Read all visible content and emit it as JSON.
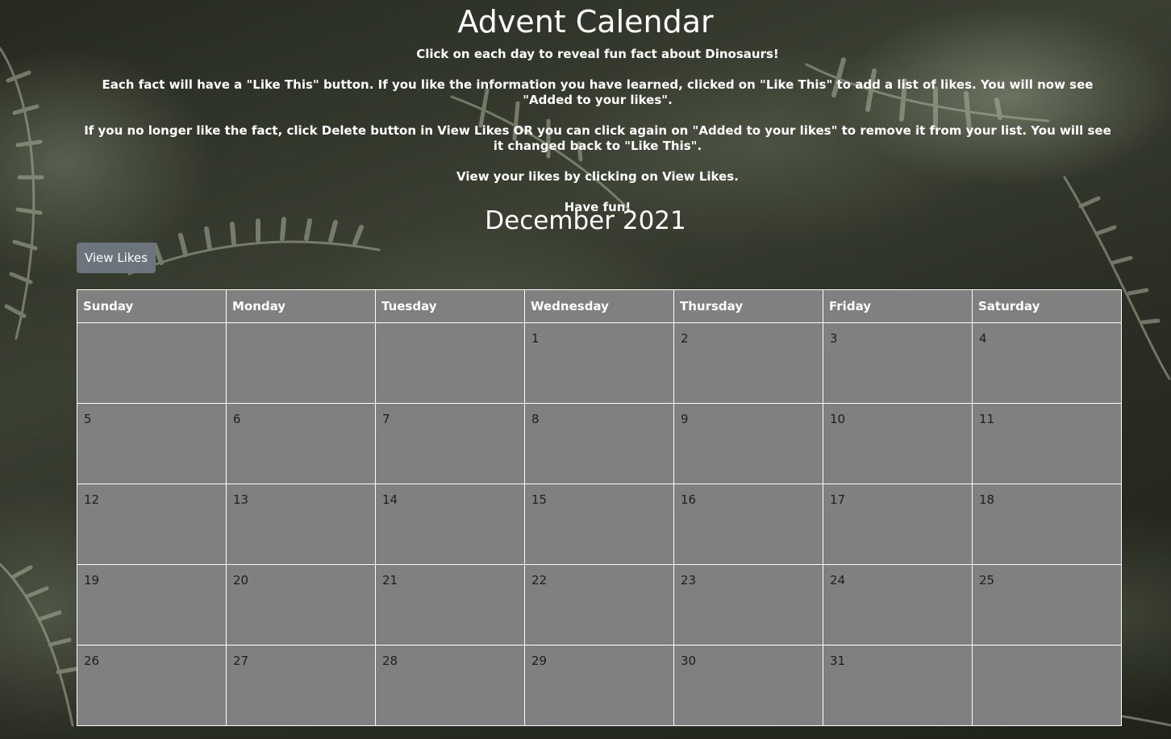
{
  "page": {
    "title": "Advent Calendar",
    "instructions": [
      "Click on each day to reveal fun fact about Dinosaurs!",
      "Each fact will have a \"Like This\" button. If you like the information you have learned, clicked on \"Like This\" to add a list of likes. You will now see \"Added to your likes\".",
      "If you no longer like the fact, click Delete button in View Likes OR you can click again on \"Added to your likes\" to remove it from your list. You will see it changed back to \"Like This\".",
      "View your likes by clicking on View Likes.",
      "Have fun!"
    ]
  },
  "calendar": {
    "month_label": "December 2021",
    "view_likes_label": "View Likes",
    "weekdays": [
      "Sunday",
      "Monday",
      "Tuesday",
      "Wednesday",
      "Thursday",
      "Friday",
      "Saturday"
    ],
    "weeks": [
      [
        "",
        "",
        "",
        "1",
        "2",
        "3",
        "4"
      ],
      [
        "5",
        "6",
        "7",
        "8",
        "9",
        "10",
        "11"
      ],
      [
        "12",
        "13",
        "14",
        "15",
        "16",
        "17",
        "18"
      ],
      [
        "19",
        "20",
        "21",
        "22",
        "23",
        "24",
        "25"
      ],
      [
        "26",
        "27",
        "28",
        "29",
        "30",
        "31",
        ""
      ]
    ]
  },
  "colors": {
    "cell_background": "#808080",
    "button_background": "#6c757d",
    "grid_lines": "#ffffff"
  }
}
